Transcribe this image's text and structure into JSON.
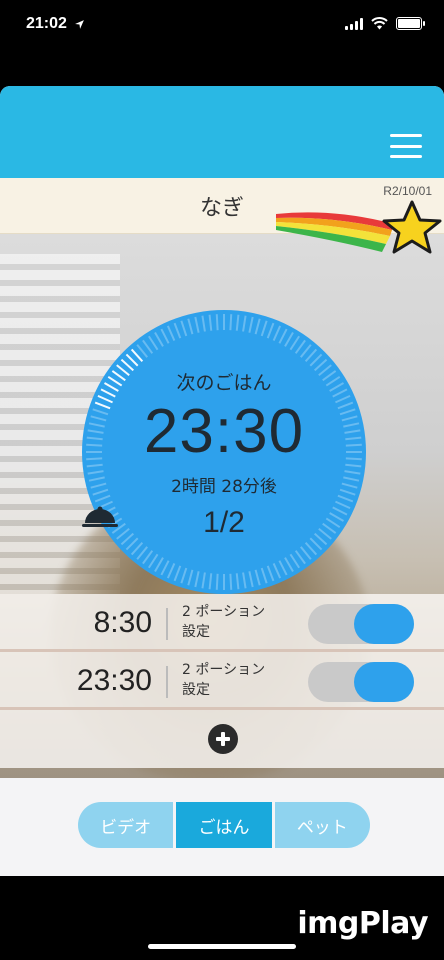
{
  "status_bar": {
    "time": "21:02"
  },
  "header": {
    "pet_name": "なぎ",
    "date": "R2/10/01"
  },
  "next_meal": {
    "heading": "次のごはん",
    "time": "23:30",
    "countdown": "2時間 28分後",
    "portion_progress": "1/2"
  },
  "schedule": [
    {
      "time": "8:30",
      "portion_line1": "2 ポーション",
      "portion_line2": "設定",
      "enabled": true
    },
    {
      "time": "23:30",
      "portion_line1": "2 ポーション",
      "portion_line2": "設定",
      "enabled": true
    }
  ],
  "tabs": [
    {
      "label": "ビデオ"
    },
    {
      "label": "ごはん",
      "active": true
    },
    {
      "label": "ペット"
    }
  ],
  "watermark": "imgPlay",
  "colors": {
    "header": "#2ab8e4",
    "dial": "#2ea1ec",
    "tab_active": "#1aa9dc",
    "tab_inactive": "#8fd3ef"
  },
  "icons": [
    "location-arrow-icon",
    "signal-icon",
    "wifi-icon",
    "battery-icon",
    "hamburger-menu-icon",
    "shooting-star-icon",
    "food-bowl-icon",
    "plus-icon"
  ]
}
